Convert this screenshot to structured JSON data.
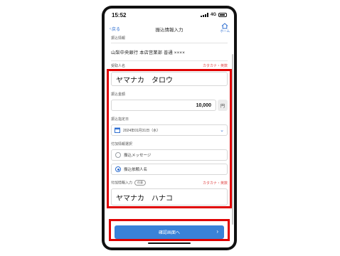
{
  "status_bar": {
    "time": "15:52",
    "network": "4G"
  },
  "nav": {
    "back_label": "戻る",
    "title": "振込情報入力",
    "home_label": "ホーム"
  },
  "transfer_info": {
    "section_label": "振込情報",
    "account_text": "山梨中央銀行 本店営業部 普通 ××××"
  },
  "recipient": {
    "label": "受取人名",
    "hint": "カタカナ・英数",
    "value": "ヤマナカ　タロウ"
  },
  "amount": {
    "label": "振込金額",
    "value": "10,000",
    "unit": "円"
  },
  "date": {
    "label": "振込指定日",
    "value": "2024年01月31日（水）"
  },
  "additional": {
    "label": "付加情報選択",
    "options": [
      {
        "label": "振込メッセージ",
        "selected": false
      },
      {
        "label": "振込依頼人名",
        "selected": true
      }
    ]
  },
  "additional_input": {
    "label": "付加情報入力",
    "badge": "任意",
    "hint": "カタカナ・英数",
    "value": "ヤマナカ　ハナコ"
  },
  "confirm_button": {
    "label": "確認画面へ"
  },
  "colors": {
    "accent": "#3a82d8",
    "highlight": "#e00000",
    "required": "#e04848"
  },
  "icons": [
    "chevron-left-icon",
    "home-icon",
    "calendar-icon",
    "chevron-down-icon",
    "chevron-right-icon"
  ]
}
